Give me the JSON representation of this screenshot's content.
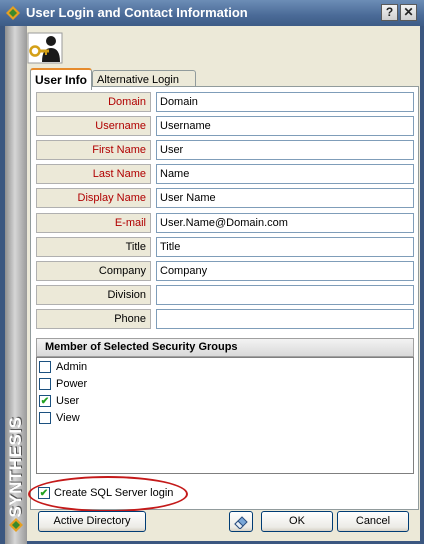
{
  "window": {
    "title": "User Login and Contact Information",
    "help_label": "?",
    "close_label": "✕"
  },
  "sidebar": {
    "brand": "SYNTHESIS"
  },
  "tabs": [
    {
      "label": "User Info"
    },
    {
      "label": "Alternative Login"
    }
  ],
  "fields": [
    {
      "label": "Domain",
      "value": "Domain",
      "required": true
    },
    {
      "label": "Username",
      "value": "Username",
      "required": true
    },
    {
      "label": "First Name",
      "value": "User",
      "required": true
    },
    {
      "label": "Last Name",
      "value": "Name",
      "required": true
    },
    {
      "label": "Display Name",
      "value": "User Name",
      "required": true
    },
    {
      "label": "E-mail",
      "value": "User.Name@Domain.com",
      "required": true
    },
    {
      "label": "Title",
      "value": "Title",
      "required": false
    },
    {
      "label": "Company",
      "value": "Company",
      "required": false
    },
    {
      "label": "Division",
      "value": "",
      "required": false
    },
    {
      "label": "Phone",
      "value": "",
      "required": false
    }
  ],
  "groups": {
    "header": "Member of Selected Security Groups",
    "items": [
      {
        "label": "Admin",
        "checked": false,
        "mark": ""
      },
      {
        "label": "Power",
        "checked": false,
        "mark": ""
      },
      {
        "label": "User",
        "checked": true,
        "mark": "✔"
      },
      {
        "label": "View",
        "checked": false,
        "mark": ""
      }
    ]
  },
  "sql_login": {
    "label": "Create SQL Server login",
    "checked": true,
    "mark": "✔"
  },
  "buttons": {
    "active_directory": "Active Directory",
    "ok": "OK",
    "cancel": "Cancel"
  },
  "colors": {
    "required_label": "#b00000",
    "title_bar": "#4a6a97",
    "highlight_ellipse": "#c41a1a"
  }
}
